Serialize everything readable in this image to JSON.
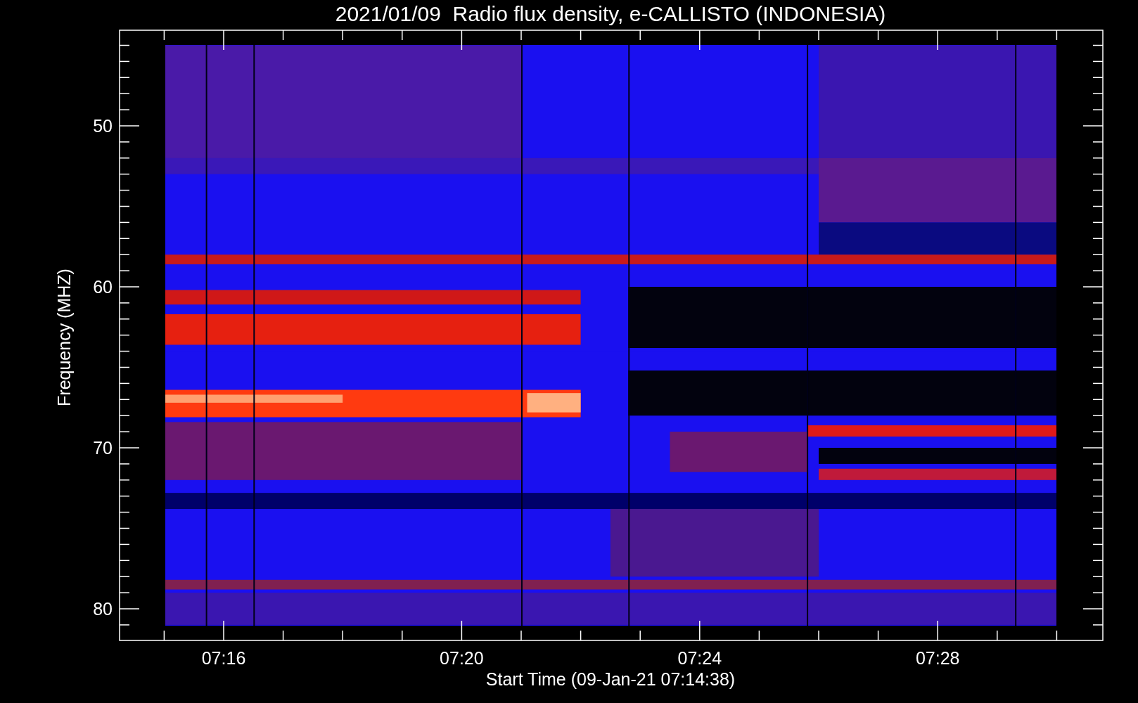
{
  "title": "2021/01/09  Radio flux density, e-CALLISTO (INDONESIA)",
  "y_axis": {
    "label": "Frequency (MHZ)",
    "ticks": [
      "50",
      "60",
      "70",
      "80"
    ]
  },
  "x_axis": {
    "label": "Start Time (09-Jan-21 07:14:38)",
    "ticks": [
      "07:16",
      "07:20",
      "07:24",
      "07:28"
    ]
  }
}
